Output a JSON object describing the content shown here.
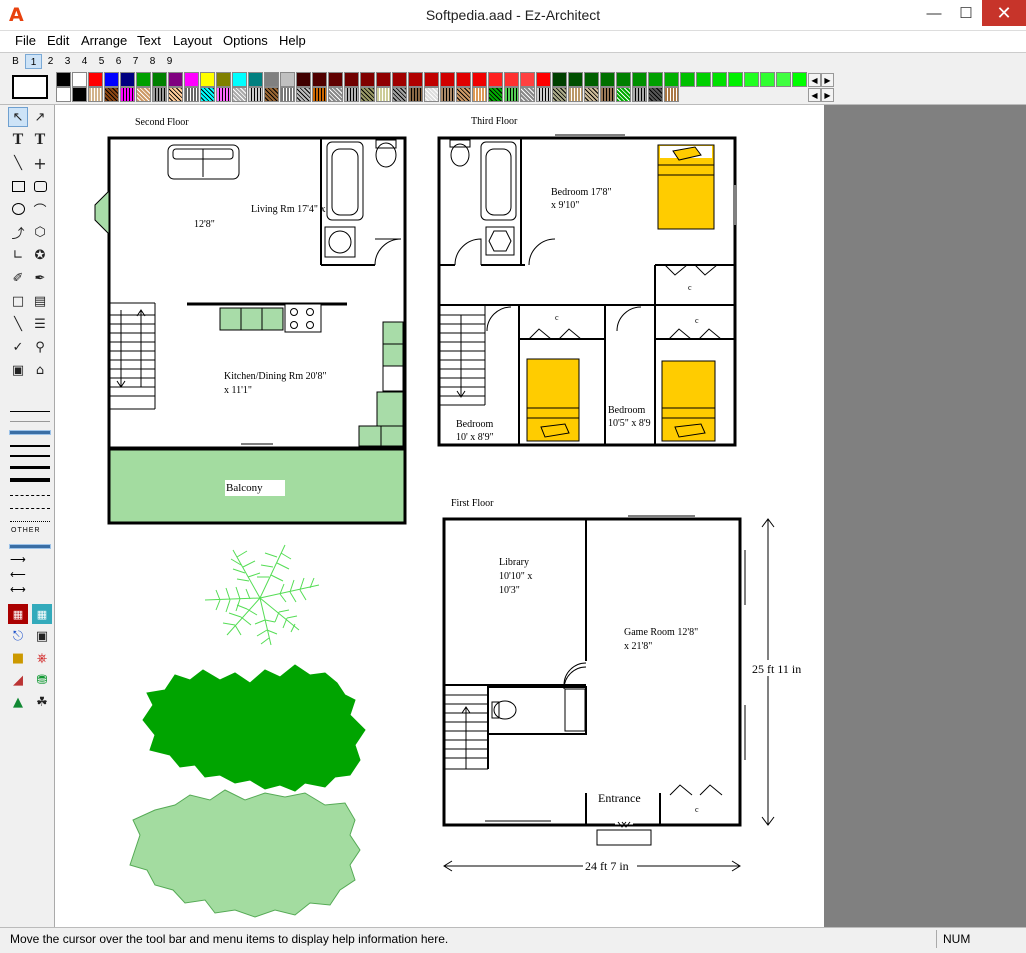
{
  "window": {
    "title": "Softpedia.aad - Ez-Architect",
    "app_icon": "A"
  },
  "menu": [
    "File",
    "Edit",
    "Arrange",
    "Text",
    "Layout",
    "Options",
    "Help"
  ],
  "layers": [
    "B",
    "1",
    "2",
    "3",
    "4",
    "5",
    "6",
    "7",
    "8",
    "9"
  ],
  "active_layer": "1",
  "palette": {
    "colors": [
      "#000000",
      "#ffffff",
      "#ff0000",
      "#0000ff",
      "#000080",
      "#00a000",
      "#008000",
      "#800080",
      "#ff00ff",
      "#ffff00",
      "#808000",
      "#00ffff",
      "#008080",
      "#808080",
      "#c0c0c0"
    ],
    "reds": [
      "#400000",
      "#500000",
      "#600000",
      "#700000",
      "#800000",
      "#900000",
      "#a00000",
      "#b00000",
      "#c00000",
      "#d00000",
      "#e00000",
      "#f00000",
      "#ff2020",
      "#ff3030",
      "#ff4040",
      "#ff0000"
    ],
    "greens": [
      "#004000",
      "#005000",
      "#006000",
      "#007000",
      "#008000",
      "#009000",
      "#00a000",
      "#00b000",
      "#00c000",
      "#00d000",
      "#00e000",
      "#00f000",
      "#20ff20",
      "#30ff30",
      "#40ff40",
      "#00ff00"
    ],
    "pattern_colors": [
      "#d2b48c",
      "#8b4513",
      "#ff00ff",
      "#cc9966",
      "#999999",
      "#ffcc99",
      "#666666",
      "#00ffff",
      "#ff66ff",
      "#aaaaaa",
      "#cccccc",
      "#996633",
      "#777777",
      "#bbbbbb",
      "#cc6600",
      "#888888",
      "#b3b3b3",
      "#999966",
      "#cccc99",
      "#a0a0a0",
      "#886644",
      "#dddddd",
      "#aa8866",
      "#cc9966",
      "#dd9955",
      "#00aa00",
      "#55cc55",
      "#888888",
      "#cfcfcf",
      "#aaaa88",
      "#bb9966",
      "#ccbb99",
      "#997755",
      "#00aa00",
      "#aaaaaa",
      "#555555",
      "#aa7744"
    ]
  },
  "toolbox": {
    "tools": [
      "pointer-icon",
      "rotate-pointer-icon",
      "text-icon",
      "text-vertical-icon",
      "line-icon",
      "cross-line-icon",
      "rectangle-icon",
      "rounded-rectangle-icon",
      "circle-icon",
      "arc-icon",
      "curve-icon",
      "polygon-icon",
      "polyline-icon",
      "star-shape-icon",
      "freehand-icon",
      "pen-icon",
      "wall-icon",
      "wall-corner-icon",
      "wall-double-icon",
      "wall-frame-icon",
      "measure-icon",
      "zoom-icon",
      "grid-snap-icon",
      "home-icon"
    ],
    "line_other_label": "OTHER",
    "symbols": [
      "door-symbol-icon",
      "window-symbol-icon",
      "sink-symbol-icon",
      "sofa-symbol-icon",
      "appliance-symbol-icon",
      "chair-symbol-icon",
      "stairs-symbol-icon",
      "car-symbol-icon",
      "tree-symbol-icon",
      "plant-symbol-icon"
    ]
  },
  "floorplan": {
    "second_floor_label": "Second Floor",
    "third_floor_label": "Third Floor",
    "first_floor_label": "First Floor",
    "living_room": [
      "Living Rm 17'4\" x",
      "12'8\""
    ],
    "kitchen": [
      "Kitchen/Dining Rm 20'8\"",
      "x 11'1\""
    ],
    "balcony": "Balcony",
    "bedroom1": [
      "Bedroom 17'8\"",
      "x 9'10\""
    ],
    "bedroom2": [
      "Bedroom",
      "10' x 8'9\""
    ],
    "bedroom3": [
      "Bedroom",
      "10'5\" x 8'9"
    ],
    "closet": "c",
    "library": [
      "Library",
      "10'10\" x",
      "10'3\""
    ],
    "game_room": [
      "Game Room 12'8\"",
      "x 21'8\""
    ],
    "entrance": "Entrance",
    "dim_vertical": "25 ft 11 in",
    "dim_horizontal": "24 ft 7 in"
  },
  "status": {
    "text": "Move the cursor over the tool bar and menu items to display help information here.",
    "num": "NUM"
  }
}
